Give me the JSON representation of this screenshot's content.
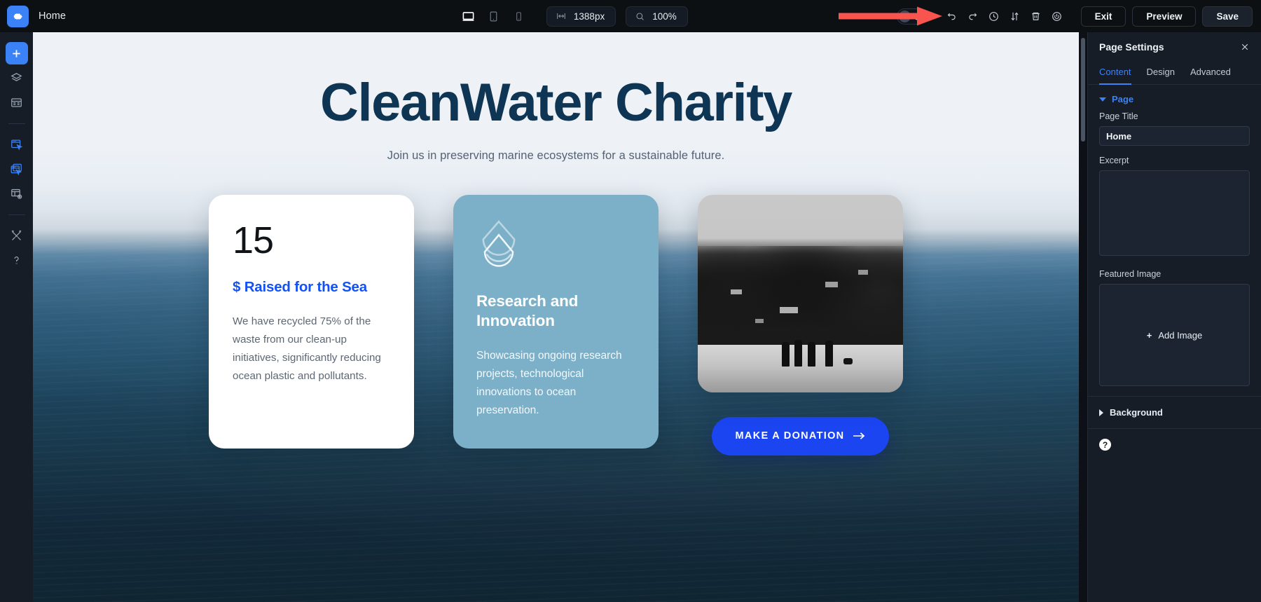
{
  "topbar": {
    "logo_icon": "gear-icon",
    "page_name": "Home",
    "devices": [
      {
        "name": "desktop",
        "icon": "desktop-icon",
        "active": true
      },
      {
        "name": "tablet",
        "icon": "tablet-icon",
        "active": false
      },
      {
        "name": "mobile",
        "icon": "mobile-icon",
        "active": false
      }
    ],
    "width_value": "1388px",
    "width_icon": "resize-horizontal-icon",
    "zoom_value": "100%",
    "zoom_icon": "magnifier-icon",
    "theme_toggle": {
      "icon": "moon-icon",
      "state": "dark"
    },
    "tools": [
      {
        "name": "undo",
        "icon": "undo-icon"
      },
      {
        "name": "redo",
        "icon": "redo-icon"
      },
      {
        "name": "history",
        "icon": "clock-icon"
      },
      {
        "name": "sort",
        "icon": "sort-arrows-icon"
      },
      {
        "name": "trash",
        "icon": "trash-icon"
      },
      {
        "name": "power",
        "icon": "power-icon"
      }
    ],
    "exit_label": "Exit",
    "preview_label": "Preview",
    "save_label": "Save"
  },
  "annotation": {
    "type": "arrow",
    "color": "#f9544d",
    "points_to": "theme-toggle"
  },
  "rail": {
    "items": [
      {
        "name": "add",
        "icon": "plus-icon",
        "active": true
      },
      {
        "name": "layers",
        "icon": "layers-icon",
        "active": false
      },
      {
        "name": "structure",
        "icon": "list-structure-icon",
        "active": false
      },
      {
        "name": "divider-1",
        "icon": "divider",
        "active": false
      },
      {
        "name": "page-select",
        "icon": "window-cursor-icon",
        "active": false
      },
      {
        "name": "template-select",
        "icon": "windows-cursor-icon",
        "active": false
      },
      {
        "name": "dynamic-data",
        "icon": "grid-settings-icon",
        "active": false
      },
      {
        "name": "divider-2",
        "icon": "divider",
        "active": false
      },
      {
        "name": "tools",
        "icon": "wrench-screwdriver-icon",
        "active": false
      },
      {
        "name": "help",
        "icon": "question-mark-icon",
        "active": false
      }
    ]
  },
  "canvas": {
    "hero": {
      "title": "CleanWater Charity",
      "subtitle": "Join us in preserving marine ecosystems for a sustainable future.",
      "title_color": "#0f3554"
    },
    "cards": [
      {
        "type": "stat",
        "number": "15",
        "title": "$ Raised for the Sea",
        "title_color": "#1451f5",
        "body": "We have recycled 75% of the waste from our clean-up initiatives, significantly reducing ocean plastic and pollutants."
      },
      {
        "type": "feature",
        "icon": "water-drop-icon",
        "bg_color": "#7cb0c8",
        "title": "Research and Innovation",
        "body": "Showcasing ongoing research projects, technological innovations to ocean preservation."
      },
      {
        "type": "photo",
        "image_alt": "black-and-white coastal hillside with people on the beach",
        "button_label": "MAKE A DONATION",
        "button_icon": "arrow-right-icon",
        "button_color": "#1b45f0"
      }
    ]
  },
  "panel": {
    "title": "Page Settings",
    "close_icon": "close-icon",
    "tabs": [
      {
        "label": "Content",
        "active": true
      },
      {
        "label": "Design",
        "active": false
      },
      {
        "label": "Advanced",
        "active": false
      }
    ],
    "sections": [
      {
        "label": "Page",
        "expanded": true
      },
      {
        "label": "Background",
        "expanded": false
      }
    ],
    "page_title_label": "Page Title",
    "page_title_value": "Home",
    "excerpt_label": "Excerpt",
    "excerpt_value": "",
    "featured_image_label": "Featured Image",
    "add_image_label": "Add Image",
    "add_image_icon": "plus-icon",
    "help_icon": "question-circle-icon"
  }
}
